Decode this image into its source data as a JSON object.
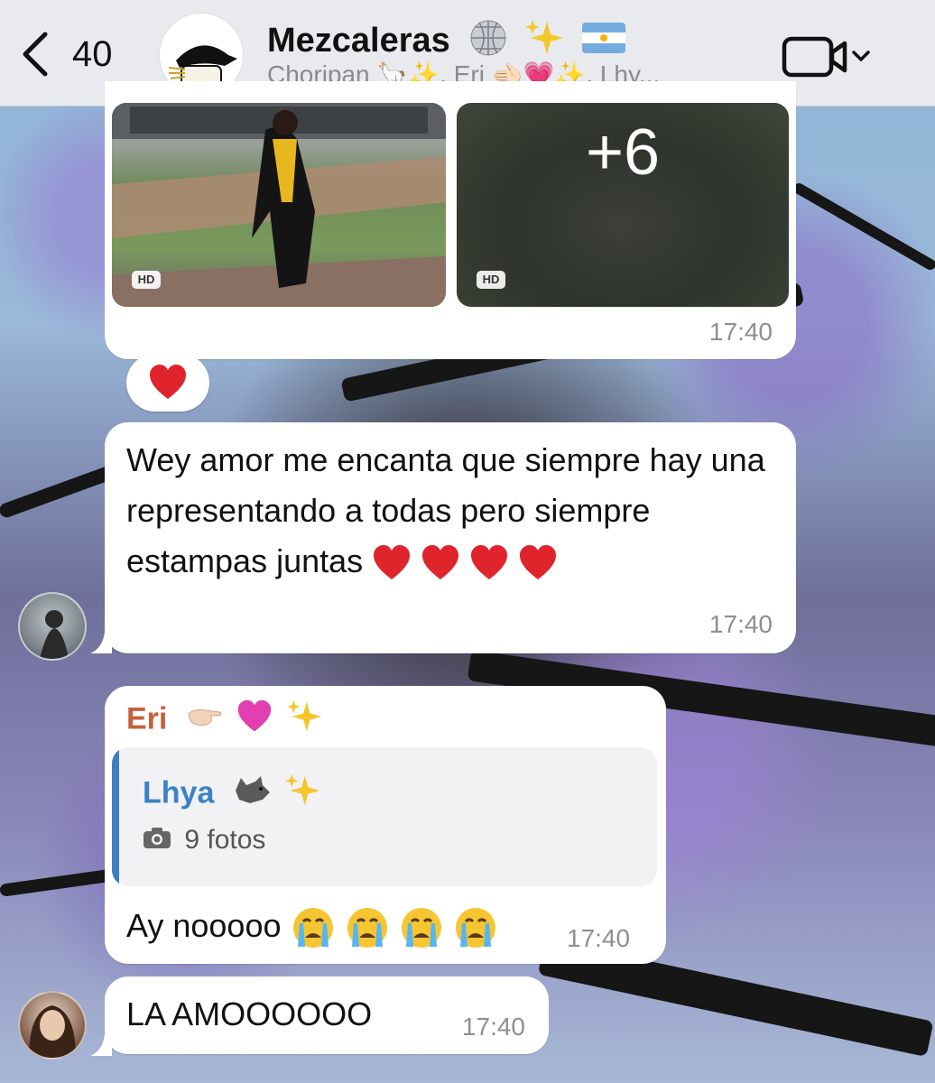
{
  "header": {
    "back_count": "40",
    "title": "Mezcaleras",
    "subtitle": "Choripan 🦙✨, Eri 🫲🏻💗✨, Lhy..."
  },
  "media_message": {
    "more_count": "+6",
    "hd_label_1": "HD",
    "hd_label_2": "HD",
    "time": "17:40",
    "reaction": "❤️"
  },
  "message_1": {
    "text": "Wey amor me encanta que siempre hay una representando a todas pero siempre estampas juntas",
    "time": "17:40"
  },
  "message_2": {
    "sender": "Eri",
    "quote_name": "Lhya",
    "quote_sub": "9 fotos",
    "text": "Ay nooooo",
    "time": "17:40"
  },
  "message_3": {
    "text": "LA AMOOOOOO",
    "time": "17:40"
  },
  "colors": {
    "accent_blue": "#3b82c6",
    "sender_orange": "#c4623c",
    "heart_red": "#e0242c"
  }
}
